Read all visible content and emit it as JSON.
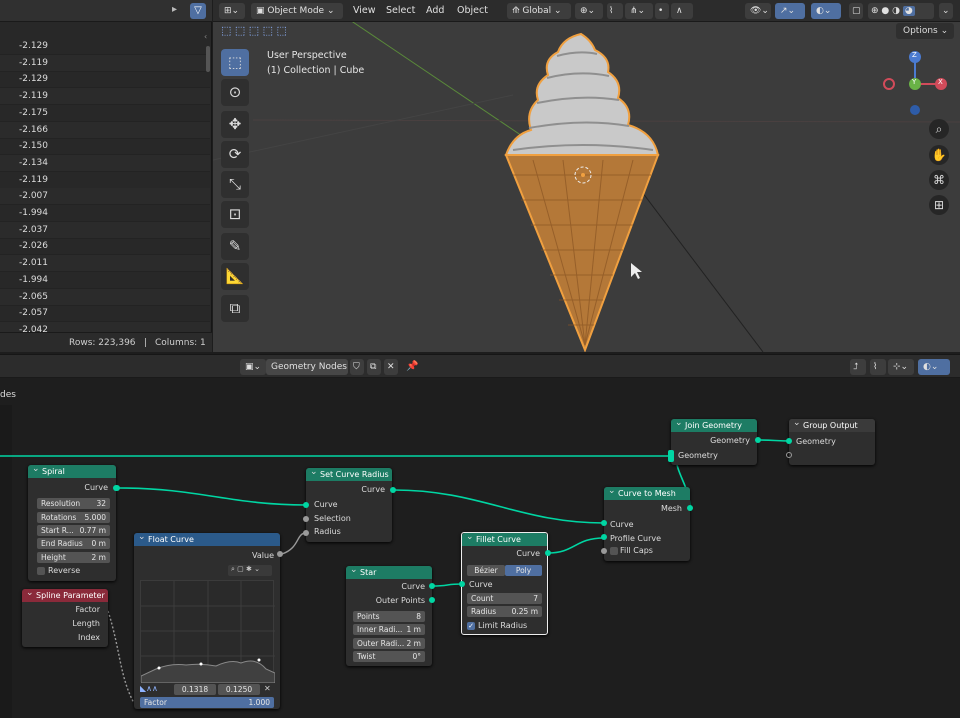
{
  "spreadsheet": {
    "values": [
      "-2.129",
      "-2.119",
      "-2.129",
      "-2.119",
      "-2.175",
      "-2.166",
      "-2.150",
      "-2.134",
      "-2.119",
      "-2.007",
      "-1.994",
      "-2.037",
      "-2.026",
      "-2.011",
      "-1.994",
      "-2.065",
      "-2.057",
      "-2.042"
    ],
    "rows_label": "Rows: 223,396",
    "columns_label": "Columns: 1",
    "separator": "|"
  },
  "viewport": {
    "mode": "Object Mode",
    "menus": [
      "View",
      "Select",
      "Add",
      "Object"
    ],
    "orientation": "Global",
    "options": "Options",
    "perspective": "User Perspective",
    "collection": "(1) Collection | Cube",
    "gizmo": {
      "z": "Z",
      "y": "Y",
      "x": "X"
    }
  },
  "node_editor": {
    "editor_name": "Geometry Nodes",
    "side_label": "des",
    "nodes": {
      "spiral": {
        "title": "Spiral",
        "out": "Curve",
        "fields": [
          [
            "Resolution",
            "32"
          ],
          [
            "Rotations",
            "5.000"
          ],
          [
            "Start R...",
            "0.77 m"
          ],
          [
            "End Radius",
            "0 m"
          ],
          [
            "Height",
            "2 m"
          ]
        ],
        "reverse": "Reverse"
      },
      "spline": {
        "title": "Spline Parameter",
        "outs": [
          "Factor",
          "Length",
          "Index"
        ]
      },
      "float_curve": {
        "title": "Float Curve",
        "out": "Value",
        "x_val": "0.1318",
        "y_val": "0.1250",
        "factor": "Factor",
        "factor_val": "1.000"
      },
      "set_radius": {
        "title": "Set Curve Radius",
        "out": "Curve",
        "ins": [
          "Curve",
          "Selection",
          "Radius"
        ]
      },
      "star": {
        "title": "Star",
        "outs": [
          "Curve",
          "Outer Points"
        ],
        "fields": [
          [
            "Points",
            "8"
          ],
          [
            "Inner Radi...",
            "1 m"
          ],
          [
            "Outer Radi...",
            "2 m"
          ],
          [
            "Twist",
            "0°"
          ]
        ]
      },
      "fillet": {
        "title": "Fillet Curve",
        "out": "Curve",
        "modes": [
          "Bézier",
          "Poly"
        ],
        "in": "Curve",
        "fields": [
          [
            "Count",
            "7"
          ],
          [
            "Radius",
            "0.25 m"
          ]
        ],
        "limit": "Limit Radius"
      },
      "to_mesh": {
        "title": "Curve to Mesh",
        "out": "Mesh",
        "ins": [
          "Curve",
          "Profile Curve",
          "Fill Caps"
        ]
      },
      "join": {
        "title": "Join Geometry",
        "out": "Geometry",
        "in": "Geometry"
      },
      "output": {
        "title": "Group Output",
        "in": "Geometry"
      }
    }
  }
}
